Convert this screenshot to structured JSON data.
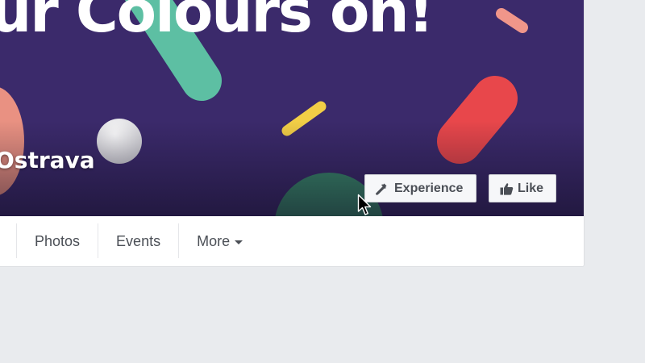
{
  "cover": {
    "headline": "ur Colours on!",
    "page_name": "Ostrava",
    "background_color": "#3b2a6b"
  },
  "actions": {
    "experience_label": "Experience",
    "experience_icon": "eyedropper-icon",
    "like_label": "Like",
    "like_icon": "thumbs-up-icon"
  },
  "nav": {
    "items": [
      {
        "label": "Photos"
      },
      {
        "label": "Events"
      },
      {
        "label": "More",
        "icon": "caret-down-icon"
      }
    ]
  }
}
